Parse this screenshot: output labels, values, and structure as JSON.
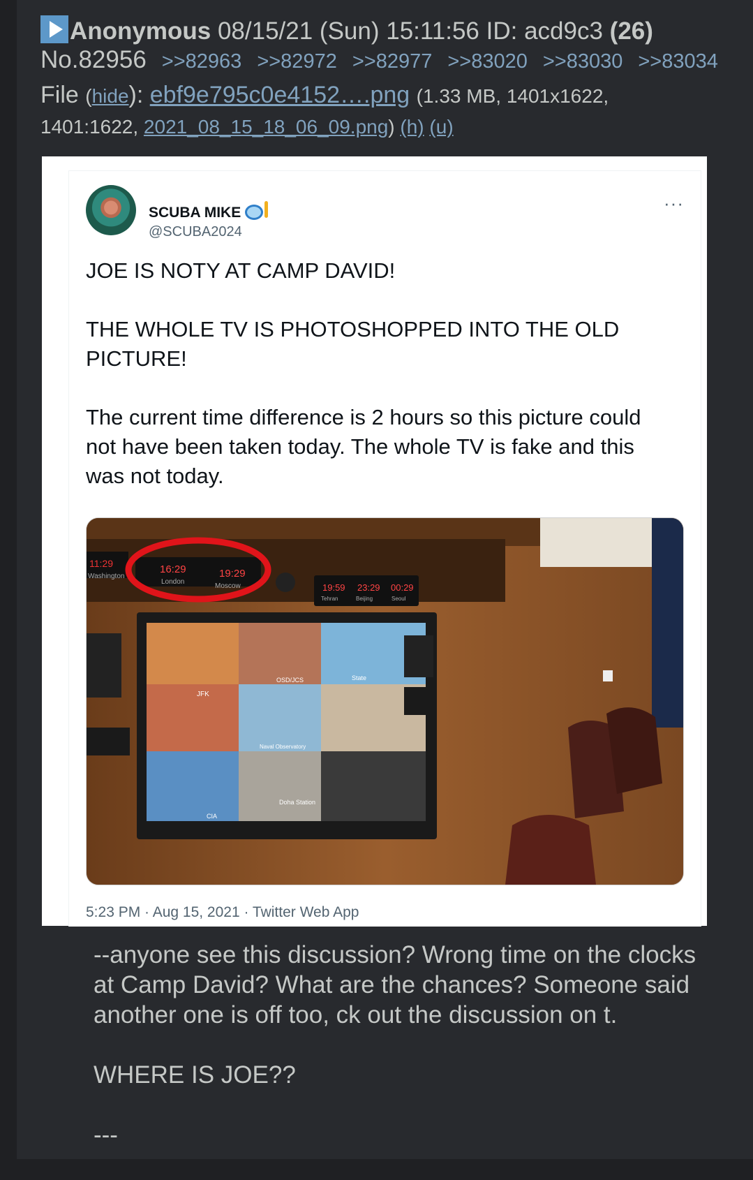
{
  "post": {
    "name": "Anonymous",
    "datetime": "08/15/21 (Sun) 15:11:56",
    "id_label": "ID: acd9c3",
    "reply_count": "(26)",
    "number": "No.82956",
    "backlinks": [
      ">>82963",
      ">>82972",
      ">>82977",
      ">>83020",
      ">>83030",
      ">>83034"
    ],
    "file": {
      "label": "File",
      "hide_open": "(",
      "hide": "hide",
      "hide_close": "):",
      "filename": "ebf9e795c0e4152….png",
      "info_a": "(1.33 MB, 1401x1622,",
      "info_b": "1401:1622,",
      "original_name": "2021_08_15_18_06_09.png",
      "h": "(h)",
      "u": "(u)"
    },
    "message": [
      "--anyone see this discussion? Wrong time on the clocks at Camp David? What are the chances? Someone said another one is off too, ck out the discussion on t.",
      "WHERE IS JOE??",
      "---"
    ]
  },
  "tweet": {
    "display_name": "SCUBA MIKE",
    "handle": "@SCUBA2024",
    "more": "···",
    "paragraphs": [
      "JOE IS NOTY AT CAMP DAVID!",
      "THE WHOLE TV IS PHOTOSHOPPED INTO THE OLD PICTURE!",
      "The current time difference is 2 hours so this picture could not have been taken today. The whole TV is fake and this was not today."
    ],
    "meta": "5:23 PM · Aug 15, 2021 · Twitter Web App"
  },
  "photo": {
    "clocks": [
      {
        "time": "11:29",
        "city": "Washington"
      },
      {
        "time": "16:29",
        "city": "London"
      },
      {
        "time": "19:29",
        "city": "Moscow"
      },
      {
        "time": "19:59",
        "city": "Tehran"
      },
      {
        "time": "23:29",
        "city": "Beijing"
      },
      {
        "time": "00:29",
        "city": "Seoul"
      }
    ],
    "screen_labels": [
      "JFK",
      "OSD/JCS",
      "State",
      "Naval Observatory",
      "CIA",
      "Doha Station"
    ]
  }
}
